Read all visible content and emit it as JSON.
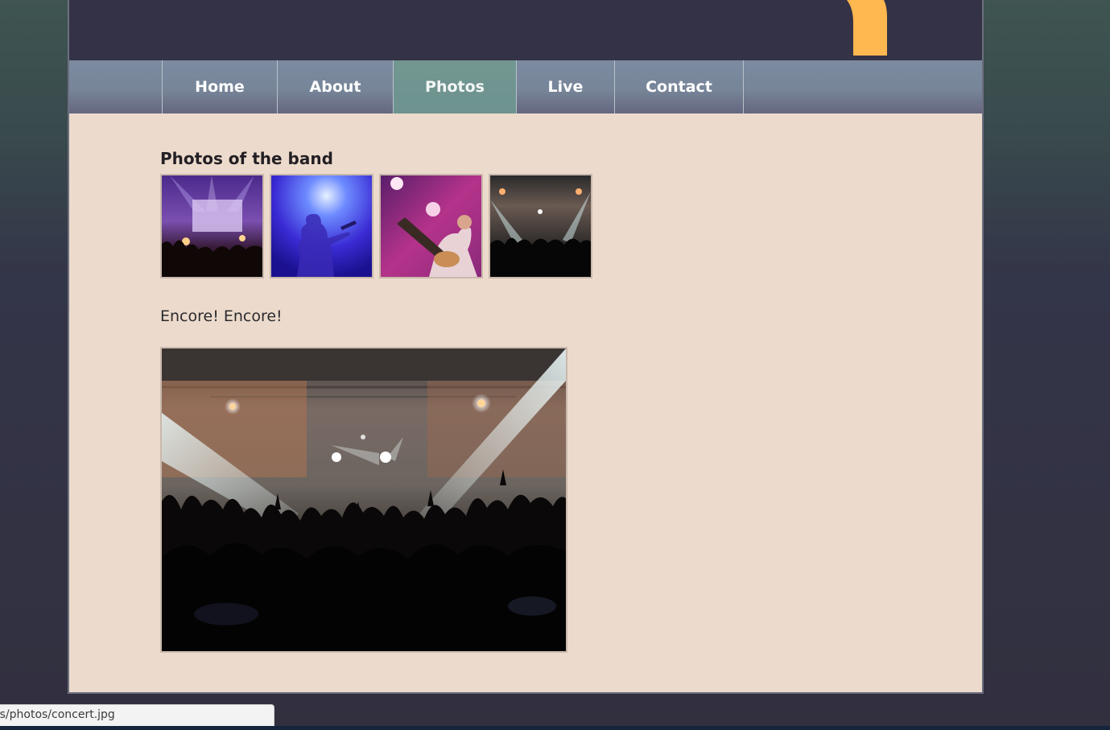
{
  "nav": {
    "items": [
      {
        "label": "Home"
      },
      {
        "label": "About"
      },
      {
        "label": "Photos",
        "active": true
      },
      {
        "label": "Live"
      },
      {
        "label": "Contact"
      }
    ]
  },
  "content": {
    "heading": "Photos of the band",
    "thumbnails": [
      {
        "name": "band-stage-photo"
      },
      {
        "name": "guitarist-silhouette-photo"
      },
      {
        "name": "guitarist-pink-photo"
      },
      {
        "name": "concert-crowd-photo"
      }
    ],
    "caption": "Encore! Encore!",
    "featured_photo": "concert-crowd-photo"
  },
  "status_bar": {
    "url": "es/photos/concert.jpg"
  },
  "colors": {
    "masthead": "#343246",
    "logo_accent": "#ffb74f",
    "nav_active": "#739690",
    "content_bg": "#ecdbcc"
  }
}
